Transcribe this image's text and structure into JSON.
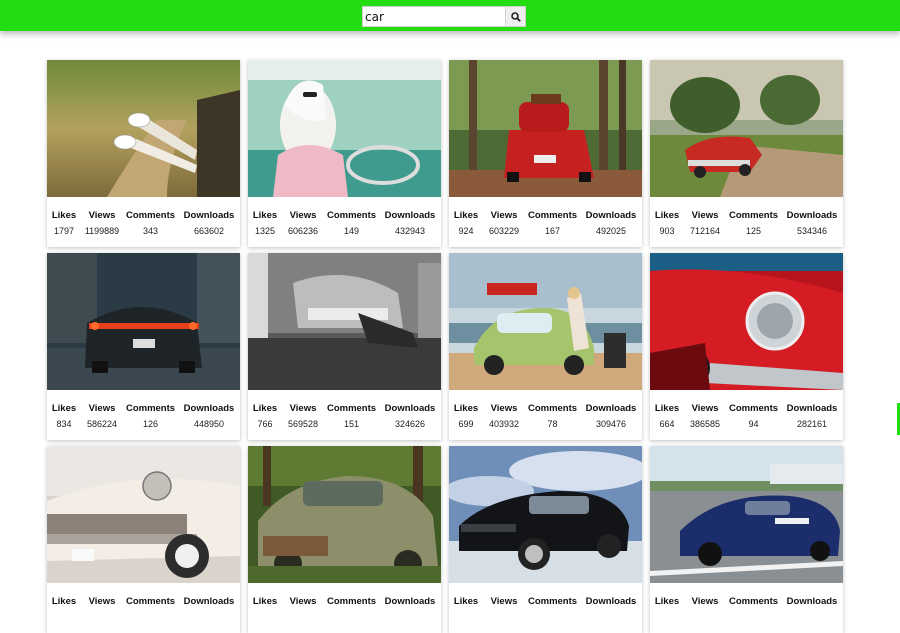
{
  "search": {
    "value": "car",
    "button_icon": "search-icon"
  },
  "labels": {
    "likes": "Likes",
    "views": "Views",
    "comments": "Comments",
    "downloads": "Downloads"
  },
  "colors": {
    "accent": "#22dd10"
  },
  "cards": [
    {
      "likes": "1797",
      "views": "1199889",
      "comments": "343",
      "downloads": "663602"
    },
    {
      "likes": "1325",
      "views": "606236",
      "comments": "149",
      "downloads": "432943"
    },
    {
      "likes": "924",
      "views": "603229",
      "comments": "167",
      "downloads": "492025"
    },
    {
      "likes": "903",
      "views": "712164",
      "comments": "125",
      "downloads": "534346"
    },
    {
      "likes": "834",
      "views": "586224",
      "comments": "126",
      "downloads": "448950"
    },
    {
      "likes": "766",
      "views": "569528",
      "comments": "151",
      "downloads": "324626"
    },
    {
      "likes": "699",
      "views": "403932",
      "comments": "78",
      "downloads": "309476"
    },
    {
      "likes": "664",
      "views": "386585",
      "comments": "94",
      "downloads": "282161"
    },
    {
      "likes": "",
      "views": "",
      "comments": "",
      "downloads": ""
    },
    {
      "likes": "",
      "views": "",
      "comments": "",
      "downloads": ""
    },
    {
      "likes": "",
      "views": "",
      "comments": "",
      "downloads": ""
    },
    {
      "likes": "",
      "views": "",
      "comments": "",
      "downloads": ""
    }
  ]
}
